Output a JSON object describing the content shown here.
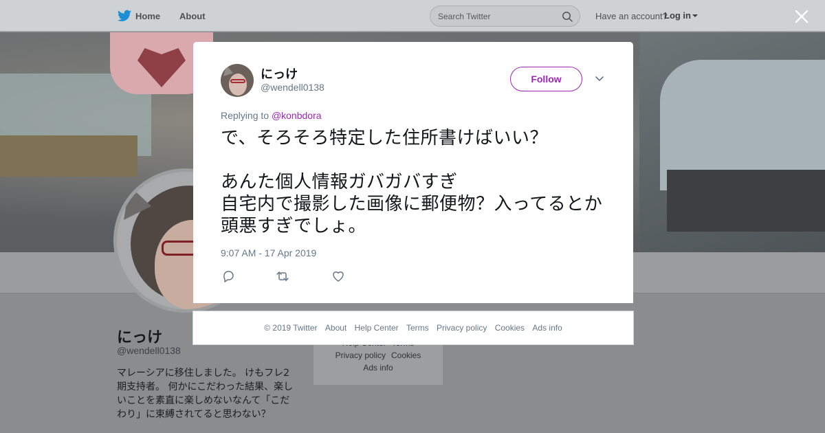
{
  "topbar": {
    "home_label": "Home",
    "about_label": "About",
    "search_placeholder": "Search Twitter",
    "account_prompt": "Have an account?",
    "login_label": "Log in"
  },
  "profile": {
    "name": "にっけ",
    "handle": "@wendell0138",
    "bio": "マレーシアに移住しました。 けもフレ2期支持者。 何かにこだわった結果、楽しいことを素直に楽しめないなんて「こだわり」に束縛されてると思わない？",
    "side_links_row1": [
      "Help Center",
      "Terms"
    ],
    "side_links_row2": [
      "Privacy policy",
      "Cookies"
    ],
    "side_links_row3": [
      "Ads info"
    ]
  },
  "tweet": {
    "author_name": "にっけ",
    "author_handle": "@wendell0138",
    "follow_label": "Follow",
    "replying_prefix": "Replying to",
    "replying_handle": "@konbdora",
    "text": "で、そろそろ特定した住所書けばいい？\n\nあんた個人情報ガバガバすぎ\n自宅内で撮影した画像に郵便物？入ってるとか頭悪すぎでしょ。",
    "timestamp": "9:07 AM - 17 Apr 2019"
  },
  "footer": {
    "links": [
      "© 2019 Twitter",
      "About",
      "Help Center",
      "Terms",
      "Privacy policy",
      "Cookies",
      "Ads info"
    ]
  },
  "colors": {
    "accent": "#9c27b0",
    "twitter_blue": "#1da1f2",
    "secondary_text": "#657786"
  }
}
